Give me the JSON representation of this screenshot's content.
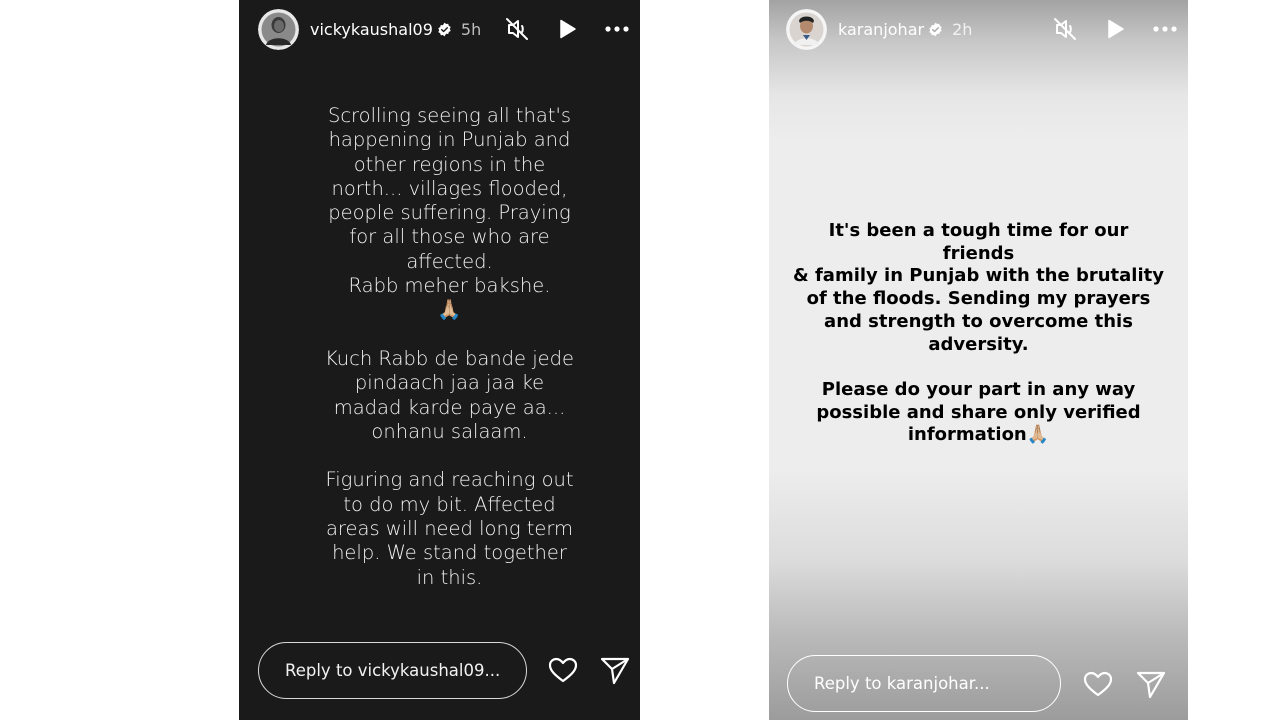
{
  "left_story": {
    "username": "vickykaushal09",
    "time": "5h",
    "text": "Scrolling seeing all that's\nhappening in Punjab and\nother regions in the\nnorth... villages flooded,\npeople suffering. Praying\nfor all those who are\naffected.\nRabb meher bakshe.\n🙏🏼\n\nKuch Rabb de bande jede\npindaach jaa jaa ke\nmadad karde paye aa...\nonhanu salaam.\n\nFiguring and reaching out\nto do my bit. Affected\nareas will need long term\nhelp. We stand together\nin this.",
    "reply_placeholder": "Reply to vickykaushal09...",
    "icons": [
      "verified-badge",
      "muted-speaker-icon",
      "play-icon",
      "more-icon",
      "heart-icon",
      "send-icon"
    ]
  },
  "right_story": {
    "username": "karanjohar",
    "time": "2h",
    "text": "It's been a tough time for our friends\n& family in Punjab with the brutality\nof the floods. Sending my prayers\nand strength to overcome this\nadversity.\n\nPlease do your part in any way\npossible and share only verified\ninformation🙏🏼",
    "reply_placeholder": "Reply to karanjohar...",
    "icons": [
      "verified-badge",
      "muted-speaker-icon",
      "play-icon",
      "more-icon",
      "heart-icon",
      "send-icon"
    ]
  },
  "colors": {
    "left_background": "#1a1a1a",
    "right_background": "#ededed",
    "page_background": "#ffffff"
  }
}
